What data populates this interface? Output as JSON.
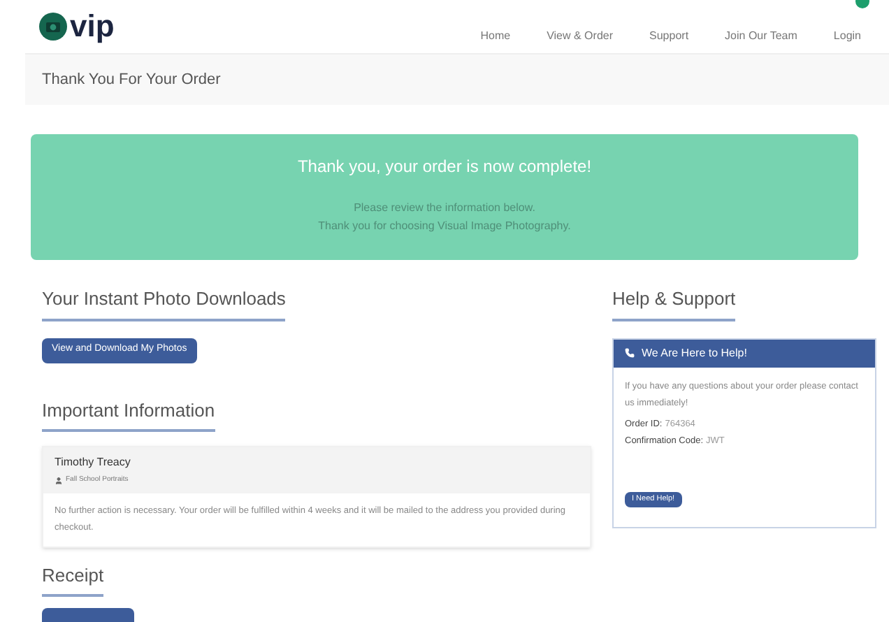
{
  "nav": {
    "logo": "vip",
    "items": [
      {
        "label": "Home"
      },
      {
        "label": "View & Order"
      },
      {
        "label": "Support"
      },
      {
        "label": "Join Our Team"
      },
      {
        "label": "Login"
      }
    ]
  },
  "page_title": "Thank You For Your Order",
  "banner": {
    "heading": "Thank you, your order is now complete!",
    "lines": [
      "Please review the information below.",
      "Thank you for choosing Visual Image Photography."
    ]
  },
  "downloads": {
    "heading": "Your Instant Photo Downloads",
    "button": "View and Download My Photos"
  },
  "important": {
    "heading": "Important Information",
    "name": "Timothy Treacy",
    "event": "Fall School Portraits",
    "message": "No further action is necessary. Your order will be fulfilled within 4 weeks and it will be mailed to the address you provided during checkout."
  },
  "receipt": {
    "heading": "Receipt"
  },
  "help": {
    "heading": "Help & Support",
    "panel_title": "We Are Here to Help!",
    "intro": "If you have any questions about your order please contact us immediately!",
    "fields": [
      {
        "label": "Order ID:",
        "value": "764364"
      },
      {
        "label": "Confirmation Code:",
        "value": "JWT"
      }
    ],
    "button": "I Need Help!"
  }
}
